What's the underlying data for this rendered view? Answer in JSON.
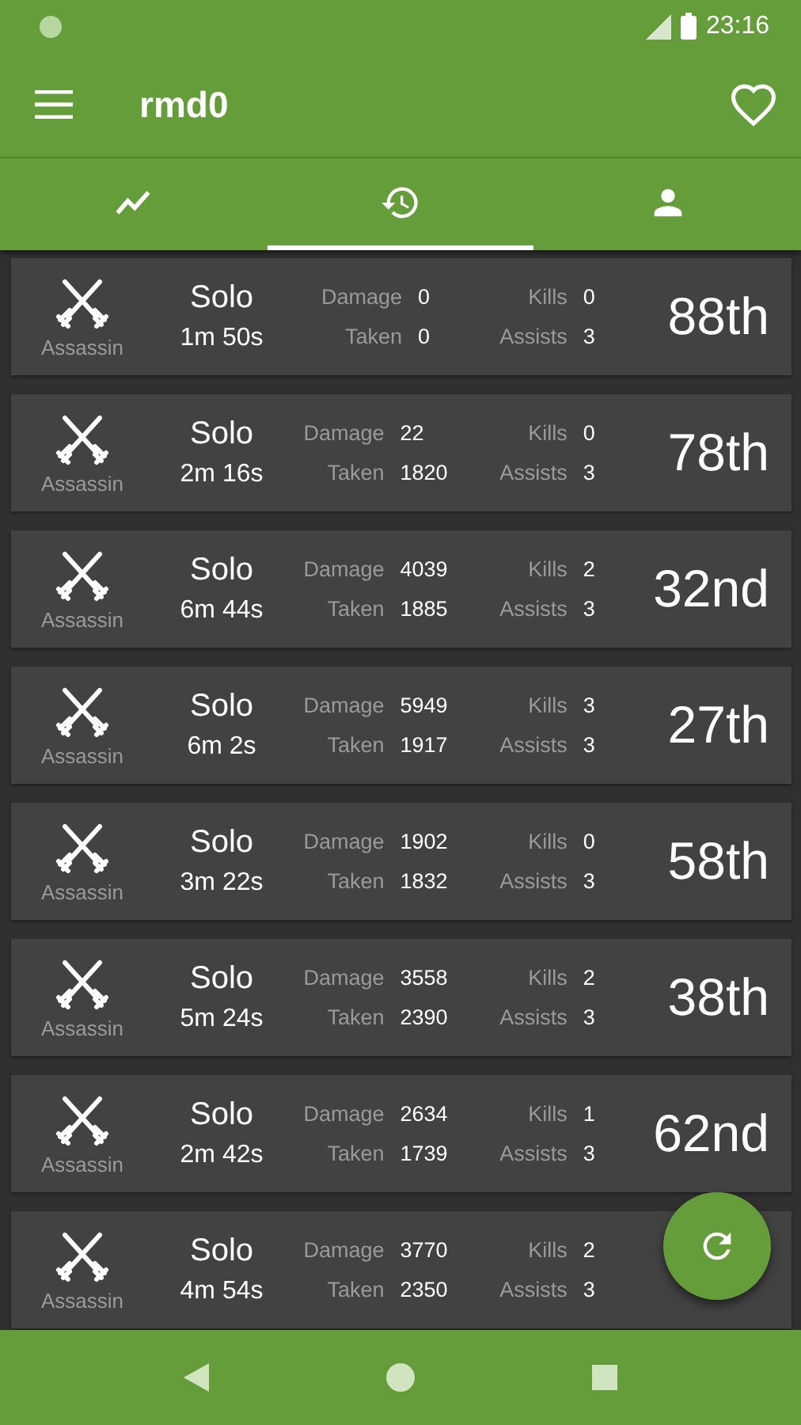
{
  "status_bar": {
    "time": "23:16"
  },
  "app_bar": {
    "title": "rmd0"
  },
  "tabs": [
    {
      "kind": "trend",
      "selected": false
    },
    {
      "kind": "history",
      "selected": true
    },
    {
      "kind": "person",
      "selected": false
    }
  ],
  "matches": [
    {
      "class": "Assassin",
      "mode": "Solo",
      "duration": "1m 50s",
      "damage_label": "Damage",
      "damage": "0",
      "taken_label": "Taken",
      "taken": "0",
      "kills_label": "Kills",
      "kills": "0",
      "assists_label": "Assists",
      "assists": "3",
      "rank": "88th"
    },
    {
      "class": "Assassin",
      "mode": "Solo",
      "duration": "2m 16s",
      "damage_label": "Damage",
      "damage": "22",
      "taken_label": "Taken",
      "taken": "1820",
      "kills_label": "Kills",
      "kills": "0",
      "assists_label": "Assists",
      "assists": "3",
      "rank": "78th"
    },
    {
      "class": "Assassin",
      "mode": "Solo",
      "duration": "6m 44s",
      "damage_label": "Damage",
      "damage": "4039",
      "taken_label": "Taken",
      "taken": "1885",
      "kills_label": "Kills",
      "kills": "2",
      "assists_label": "Assists",
      "assists": "3",
      "rank": "32nd"
    },
    {
      "class": "Assassin",
      "mode": "Solo",
      "duration": "6m 2s",
      "damage_label": "Damage",
      "damage": "5949",
      "taken_label": "Taken",
      "taken": "1917",
      "kills_label": "Kills",
      "kills": "3",
      "assists_label": "Assists",
      "assists": "3",
      "rank": "27th"
    },
    {
      "class": "Assassin",
      "mode": "Solo",
      "duration": "3m 22s",
      "damage_label": "Damage",
      "damage": "1902",
      "taken_label": "Taken",
      "taken": "1832",
      "kills_label": "Kills",
      "kills": "0",
      "assists_label": "Assists",
      "assists": "3",
      "rank": "58th"
    },
    {
      "class": "Assassin",
      "mode": "Solo",
      "duration": "5m 24s",
      "damage_label": "Damage",
      "damage": "3558",
      "taken_label": "Taken",
      "taken": "2390",
      "kills_label": "Kills",
      "kills": "2",
      "assists_label": "Assists",
      "assists": "3",
      "rank": "38th"
    },
    {
      "class": "Assassin",
      "mode": "Solo",
      "duration": "2m 42s",
      "damage_label": "Damage",
      "damage": "2634",
      "taken_label": "Taken",
      "taken": "1739",
      "kills_label": "Kills",
      "kills": "1",
      "assists_label": "Assists",
      "assists": "3",
      "rank": "62nd"
    },
    {
      "class": "Assassin",
      "mode": "Solo",
      "duration": "4m 54s",
      "damage_label": "Damage",
      "damage": "3770",
      "taken_label": "Taken",
      "taken": "2350",
      "kills_label": "Kills",
      "kills": "2",
      "assists_label": "Assists",
      "assists": "3"
    }
  ]
}
